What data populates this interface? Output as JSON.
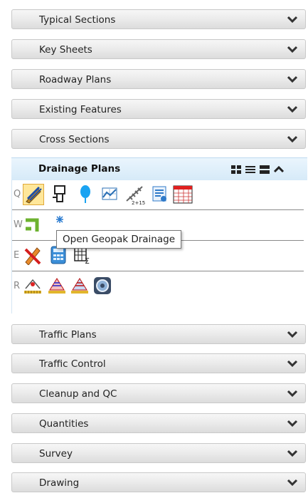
{
  "sections_top": [
    {
      "label": "Typical Sections"
    },
    {
      "label": "Key Sheets"
    },
    {
      "label": "Roadway Plans"
    },
    {
      "label": "Existing Features"
    },
    {
      "label": "Cross Sections"
    }
  ],
  "open_section": {
    "label": "Drainage Plans",
    "view_icons": [
      "grid-view-icon",
      "list-view-icon",
      "large-view-icon",
      "collapse-chevron-icon"
    ],
    "rows": [
      {
        "key": "Q",
        "tools": [
          "drainage-brush-icon",
          "inlet-structure-icon",
          "balloon-marker-icon",
          "profile-chart-icon",
          "stationing-line-icon",
          "report-list-icon",
          "calendar-grid-icon"
        ]
      },
      {
        "key": "W",
        "tools": [
          "pipe-network-icon",
          "sparkle-icon"
        ]
      },
      {
        "key": "E",
        "tools": [
          "pencil-ruler-icon",
          "calculator-icon",
          "table-sum-icon"
        ]
      },
      {
        "key": "R",
        "tools": [
          "survey-point-icon",
          "sheet-layout-icon",
          "sheet-layout-2-icon",
          "geopak-disc-icon"
        ]
      }
    ],
    "tooltip": "Open Geopak Drainage"
  },
  "sections_bottom": [
    {
      "label": "Traffic Plans"
    },
    {
      "label": "Traffic Control"
    },
    {
      "label": "Cleanup and QC"
    },
    {
      "label": "Quantities"
    },
    {
      "label": "Survey"
    },
    {
      "label": "Drawing"
    }
  ],
  "colors": {
    "header_bg": "#d6eaf8",
    "selected_tool": "#ffe79a",
    "bar_bg": "#e9e9e9"
  }
}
